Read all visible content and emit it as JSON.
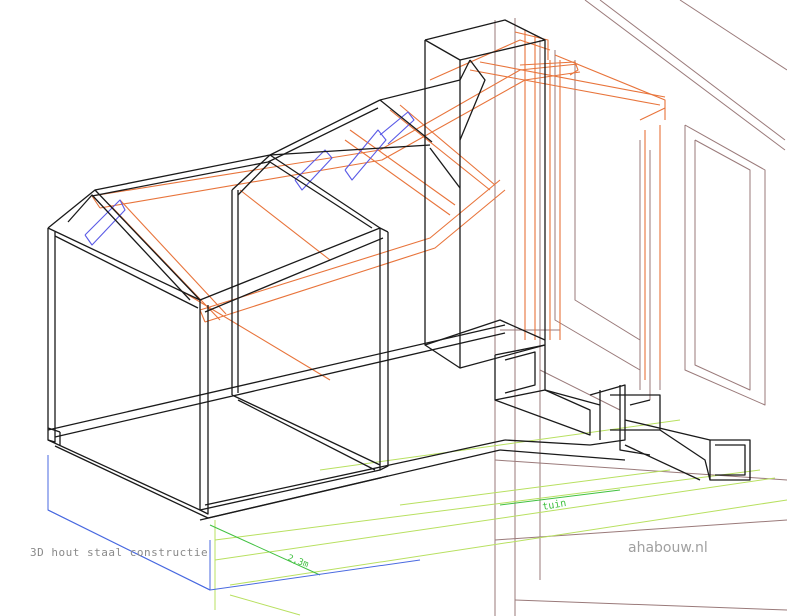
{
  "caption": "3D hout staal constructie",
  "watermark": "ahabouw.nl",
  "labels": {
    "garden": "tuin",
    "dimension": "2,3m"
  },
  "colors": {
    "frame": "#1a1a1a",
    "timber": "#e8743b",
    "steel": "#5a5ae6",
    "neighbour": "#8a6a6a",
    "foundation": "#4060d8",
    "ground": "#b8e060",
    "ground_accent": "#40c040"
  }
}
